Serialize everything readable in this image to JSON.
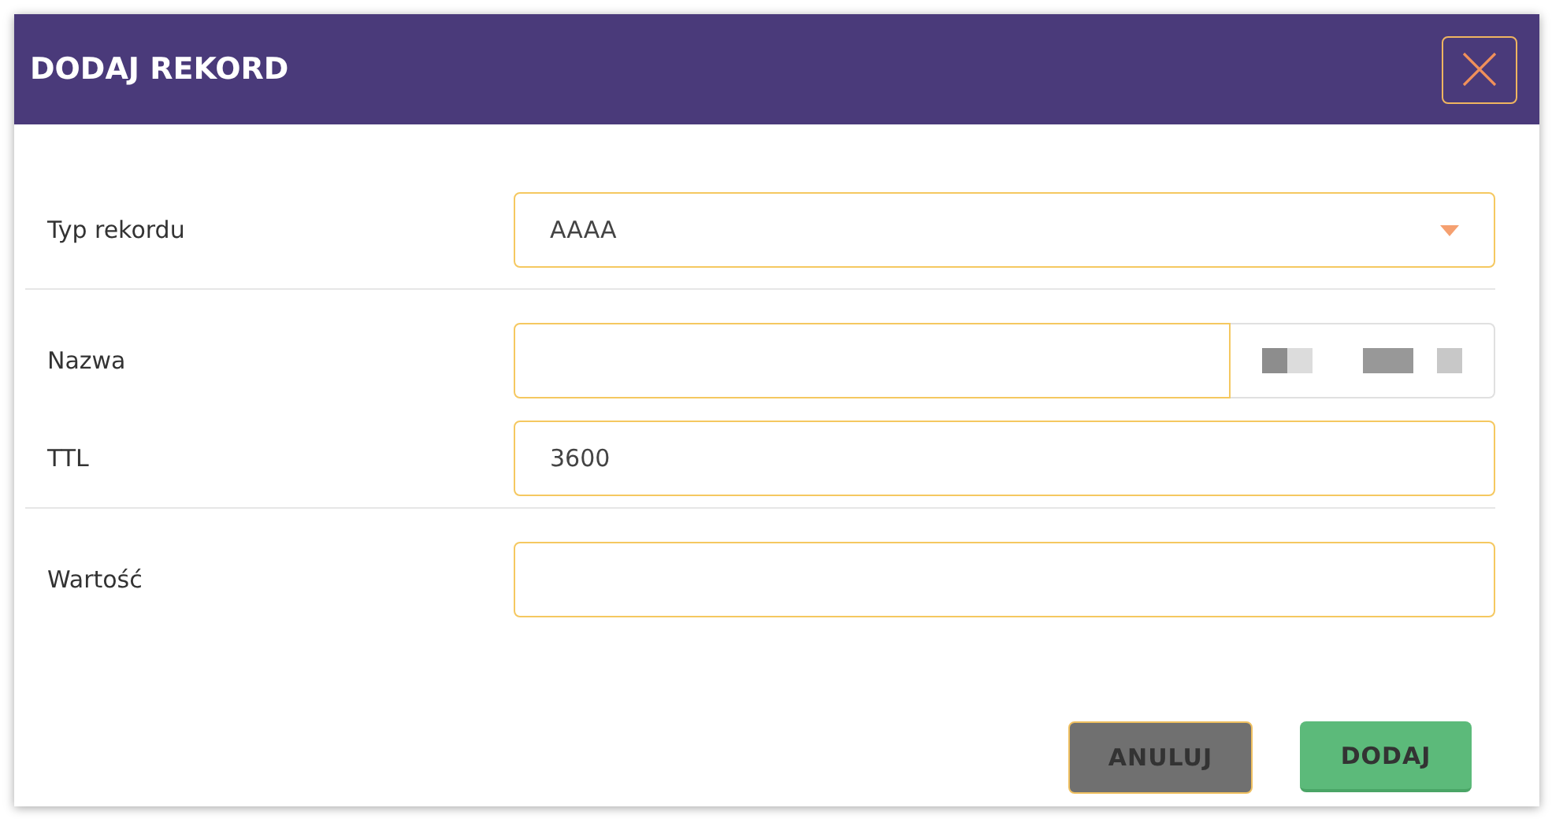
{
  "dialog": {
    "title": "DODAJ REKORD"
  },
  "fields": [
    {
      "kind": "select",
      "label": "Typ rekordu",
      "value": "AAAA"
    },
    {
      "kind": "addon",
      "label": "Nazwa"
    },
    {
      "kind": "text",
      "label": "TTL",
      "value": "3600"
    },
    {
      "kind": "text",
      "label": "Wartość"
    }
  ],
  "buttons": [
    {
      "kind": "cancel",
      "label": "ANULUJ"
    },
    {
      "kind": "primary",
      "label": "DODAJ"
    }
  ]
}
